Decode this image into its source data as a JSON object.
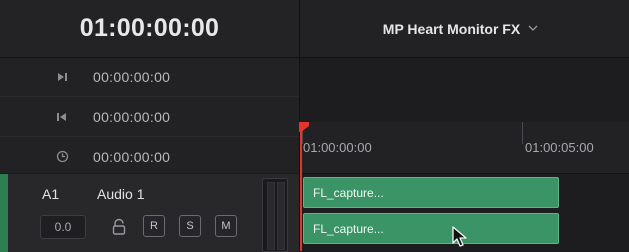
{
  "transport": {
    "current_timecode": "01:00:00:00",
    "rows": [
      {
        "icon": "mark-in-icon",
        "glyph": "▶|",
        "value": "00:00:00:00"
      },
      {
        "icon": "mark-out-icon",
        "glyph": "|◀",
        "value": "00:00:00:00"
      },
      {
        "icon": "clock-icon",
        "glyph": "◷",
        "value": "00:00:00:00"
      }
    ]
  },
  "timeline": {
    "name": "MP Heart Monitor FX",
    "ruler": {
      "start_label": "01:00:00:00",
      "mid_label": "01:00:05:00"
    },
    "clips": [
      {
        "label": "FL_capture..."
      },
      {
        "label": "FL_capture..."
      }
    ]
  },
  "track": {
    "id": "A1",
    "name": "Audio 1",
    "volume": "0.0",
    "buttons": {
      "record": "R",
      "solo": "S",
      "mute": "M"
    }
  },
  "colors": {
    "clip_green": "#3a9466",
    "track_accent": "#2f7d52",
    "playhead_red": "#e8322c"
  }
}
